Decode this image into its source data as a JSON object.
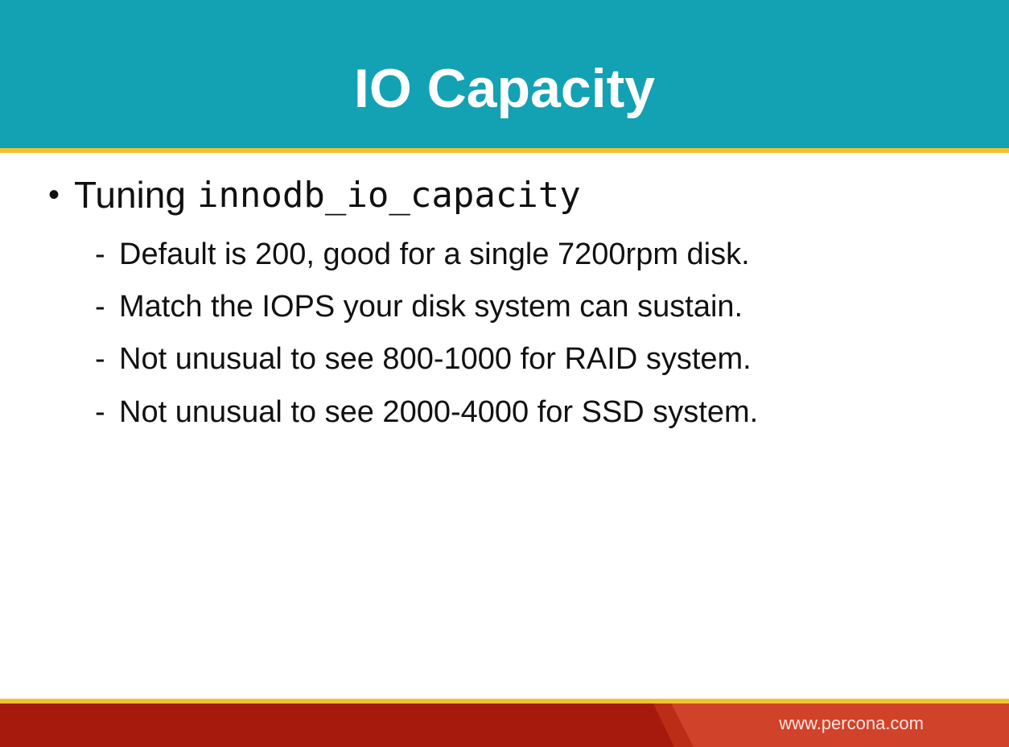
{
  "slide": {
    "title": "IO Capacity"
  },
  "content": {
    "bullet": {
      "lead": "Tuning",
      "code": "innodb_io_capacity"
    },
    "sub_items": [
      "Default is 200, good for a single 7200rpm disk.",
      "Match the IOPS your disk system can sustain.",
      "Not unusual to see 800-1000 for RAID system.",
      "Not unusual to see 2000-4000 for SSD system."
    ]
  },
  "footer": {
    "url": "www.percona.com"
  },
  "colors": {
    "header": "#12a2b3",
    "accent_rule": "#f2c230",
    "footer_dark": "#a51a0c",
    "footer_light": "#d1422a"
  }
}
